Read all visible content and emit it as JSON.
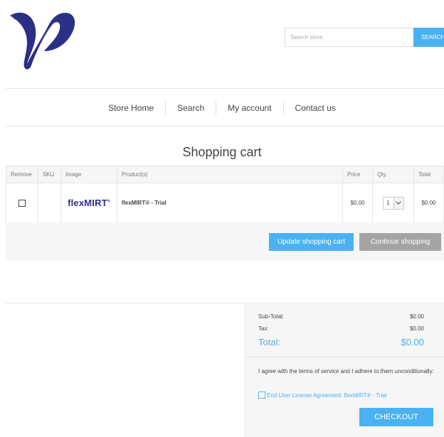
{
  "header": {
    "search": {
      "placeholder": "Search store",
      "button_label": "SEARCH"
    }
  },
  "nav": {
    "items": [
      {
        "label": "Store Home"
      },
      {
        "label": "Search"
      },
      {
        "label": "My account"
      },
      {
        "label": "Contact us"
      }
    ]
  },
  "page": {
    "title": "Shopping cart"
  },
  "cart": {
    "columns": [
      "Remove",
      "SKU",
      "Image",
      "Product(s)",
      "Price",
      "Qty.",
      "Total"
    ],
    "rows": [
      {
        "sku": "",
        "image_text": "flexMIRT",
        "image_mark": "®",
        "product": "flexMIRT® - Trial",
        "price": "$0.00",
        "qty": "1",
        "total": "$0.00"
      }
    ],
    "update_label": "Update shopping cart",
    "continue_label": "Continue shopping"
  },
  "totals": {
    "subtotal_label": "Sub-Total:",
    "subtotal_value": "$0.00",
    "tax_label": "Tax:",
    "tax_value": "$0.00",
    "total_label": "Total:",
    "total_value": "$0.00",
    "terms_text": "I agree with the terms of service and I adhere to them unconditionally:",
    "eula_label": "End User License Agreement: flexMIRT® - Trial",
    "checkout_label": "CHECKOUT"
  },
  "colors": {
    "accent": "#4ab2f1",
    "logo": "#2c2f86",
    "secondary_button": "#a4a4a4"
  }
}
